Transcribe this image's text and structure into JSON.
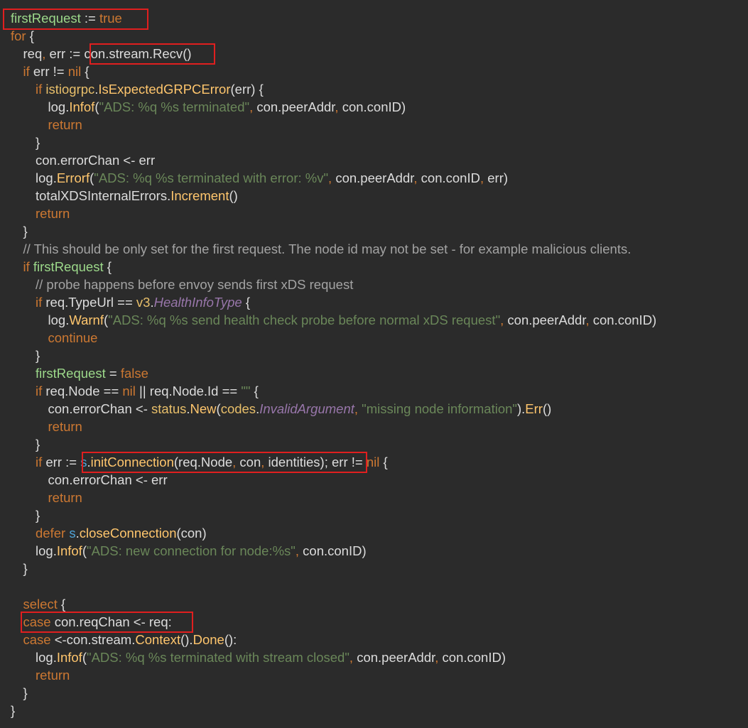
{
  "code": {
    "lines": [
      {
        "indent": 0,
        "tokens": [
          {
            "t": "firstRequest",
            "c": "var"
          },
          {
            "t": " := "
          },
          {
            "t": "true",
            "c": "kw"
          }
        ]
      },
      {
        "indent": 0,
        "tokens": [
          {
            "t": "for",
            "c": "kw"
          },
          {
            "t": " {"
          }
        ]
      },
      {
        "indent": 1,
        "tokens": [
          {
            "t": "req"
          },
          {
            "t": ", ",
            "c": "kw"
          },
          {
            "t": "err"
          },
          {
            "t": " := "
          },
          {
            "t": "con.stream.Recv"
          },
          {
            "t": "()"
          }
        ]
      },
      {
        "indent": 1,
        "tokens": [
          {
            "t": "if",
            "c": "kw"
          },
          {
            "t": " err != "
          },
          {
            "t": "nil",
            "c": "kw"
          },
          {
            "t": " {"
          }
        ]
      },
      {
        "indent": 2,
        "tokens": [
          {
            "t": "if",
            "c": "kw"
          },
          {
            "t": " "
          },
          {
            "t": "istiogrpc",
            "c": "pkg"
          },
          {
            "t": "."
          },
          {
            "t": "IsExpectedGRPCError",
            "c": "fn"
          },
          {
            "t": "(err) {"
          }
        ]
      },
      {
        "indent": 3,
        "tokens": [
          {
            "t": "log."
          },
          {
            "t": "Infof",
            "c": "fn"
          },
          {
            "t": "("
          },
          {
            "t": "\"ADS: %q %s terminated\"",
            "c": "str"
          },
          {
            "t": ", ",
            "c": "kw"
          },
          {
            "t": "con.peerAddr"
          },
          {
            "t": ", ",
            "c": "kw"
          },
          {
            "t": "con.conID)"
          }
        ]
      },
      {
        "indent": 3,
        "tokens": [
          {
            "t": "return",
            "c": "kw"
          }
        ]
      },
      {
        "indent": 2,
        "tokens": [
          {
            "t": "}"
          }
        ]
      },
      {
        "indent": 2,
        "tokens": [
          {
            "t": "con.errorChan <- err"
          }
        ]
      },
      {
        "indent": 2,
        "tokens": [
          {
            "t": "log."
          },
          {
            "t": "Errorf",
            "c": "fn"
          },
          {
            "t": "("
          },
          {
            "t": "\"ADS: %q %s terminated with error: %v\"",
            "c": "str"
          },
          {
            "t": ", ",
            "c": "kw"
          },
          {
            "t": "con.peerAddr"
          },
          {
            "t": ", ",
            "c": "kw"
          },
          {
            "t": "con.conID"
          },
          {
            "t": ", ",
            "c": "kw"
          },
          {
            "t": "err)"
          }
        ]
      },
      {
        "indent": 2,
        "tokens": [
          {
            "t": "totalXDSInternalErrors."
          },
          {
            "t": "Increment",
            "c": "fn"
          },
          {
            "t": "()"
          }
        ]
      },
      {
        "indent": 2,
        "tokens": [
          {
            "t": "return",
            "c": "kw"
          }
        ]
      },
      {
        "indent": 1,
        "tokens": [
          {
            "t": "}"
          }
        ]
      },
      {
        "indent": 1,
        "tokens": [
          {
            "t": "// This should be only set for the first request. The node id may not be set - for example malicious clients.",
            "c": "cm"
          }
        ]
      },
      {
        "indent": 1,
        "tokens": [
          {
            "t": "if",
            "c": "kw"
          },
          {
            "t": " "
          },
          {
            "t": "firstRequest",
            "c": "var"
          },
          {
            "t": " {"
          }
        ]
      },
      {
        "indent": 2,
        "tokens": [
          {
            "t": "// probe happens before envoy sends first xDS request",
            "c": "cm"
          }
        ]
      },
      {
        "indent": 2,
        "tokens": [
          {
            "t": "if",
            "c": "kw"
          },
          {
            "t": " req.TypeUrl == "
          },
          {
            "t": "v3",
            "c": "pkg"
          },
          {
            "t": "."
          },
          {
            "t": "HealthInfoType",
            "c": "it"
          },
          {
            "t": " {"
          }
        ]
      },
      {
        "indent": 3,
        "tokens": [
          {
            "t": "log."
          },
          {
            "t": "Warnf",
            "c": "fn"
          },
          {
            "t": "("
          },
          {
            "t": "\"ADS: %q %s send health check probe before normal xDS request\"",
            "c": "str"
          },
          {
            "t": ", ",
            "c": "kw"
          },
          {
            "t": "con.peerAddr"
          },
          {
            "t": ", ",
            "c": "kw"
          },
          {
            "t": "con.conID)"
          }
        ]
      },
      {
        "indent": 3,
        "tokens": [
          {
            "t": "continue",
            "c": "kw"
          }
        ]
      },
      {
        "indent": 2,
        "tokens": [
          {
            "t": "}"
          }
        ]
      },
      {
        "indent": 2,
        "tokens": [
          {
            "t": "firstRequest",
            "c": "var"
          },
          {
            "t": " = "
          },
          {
            "t": "false",
            "c": "kw"
          }
        ]
      },
      {
        "indent": 2,
        "tokens": [
          {
            "t": "if",
            "c": "kw"
          },
          {
            "t": " req.Node == "
          },
          {
            "t": "nil",
            "c": "kw"
          },
          {
            "t": " || req.Node.Id == "
          },
          {
            "t": "\"\"",
            "c": "str"
          },
          {
            "t": " {"
          }
        ]
      },
      {
        "indent": 3,
        "tokens": [
          {
            "t": "con.errorChan <- "
          },
          {
            "t": "status",
            "c": "pkg"
          },
          {
            "t": "."
          },
          {
            "t": "New",
            "c": "fn"
          },
          {
            "t": "("
          },
          {
            "t": "codes",
            "c": "pkg"
          },
          {
            "t": "."
          },
          {
            "t": "InvalidArgument",
            "c": "it"
          },
          {
            "t": ", ",
            "c": "kw"
          },
          {
            "t": "\"missing node information\"",
            "c": "str"
          },
          {
            "t": ")."
          },
          {
            "t": "Err",
            "c": "fn"
          },
          {
            "t": "()"
          }
        ]
      },
      {
        "indent": 3,
        "tokens": [
          {
            "t": "return",
            "c": "kw"
          }
        ]
      },
      {
        "indent": 2,
        "tokens": [
          {
            "t": "}"
          }
        ]
      },
      {
        "indent": 2,
        "tokens": [
          {
            "t": "if",
            "c": "kw"
          },
          {
            "t": " err := "
          },
          {
            "t": "s",
            "c": "recv"
          },
          {
            "t": "."
          },
          {
            "t": "initConnection",
            "c": "fn"
          },
          {
            "t": "(req.Node"
          },
          {
            "t": ", ",
            "c": "kw"
          },
          {
            "t": "con"
          },
          {
            "t": ", ",
            "c": "kw"
          },
          {
            "t": "identities)"
          },
          {
            "t": "; "
          },
          {
            "t": "err != "
          },
          {
            "t": "nil",
            "c": "kw"
          },
          {
            "t": " {"
          }
        ]
      },
      {
        "indent": 3,
        "tokens": [
          {
            "t": "con.errorChan <- err"
          }
        ]
      },
      {
        "indent": 3,
        "tokens": [
          {
            "t": "return",
            "c": "kw"
          }
        ]
      },
      {
        "indent": 2,
        "tokens": [
          {
            "t": "}"
          }
        ]
      },
      {
        "indent": 2,
        "tokens": [
          {
            "t": "defer",
            "c": "kw"
          },
          {
            "t": " "
          },
          {
            "t": "s",
            "c": "recv"
          },
          {
            "t": "."
          },
          {
            "t": "closeConnection",
            "c": "fn"
          },
          {
            "t": "(con)"
          }
        ]
      },
      {
        "indent": 2,
        "tokens": [
          {
            "t": "log."
          },
          {
            "t": "Infof",
            "c": "fn"
          },
          {
            "t": "("
          },
          {
            "t": "\"ADS: new connection for node:%s\"",
            "c": "str"
          },
          {
            "t": ", ",
            "c": "kw"
          },
          {
            "t": "con.conID)"
          }
        ]
      },
      {
        "indent": 1,
        "tokens": [
          {
            "t": "}"
          }
        ]
      },
      {
        "indent": 1,
        "tokens": []
      },
      {
        "indent": 1,
        "tokens": [
          {
            "t": "select",
            "c": "kw"
          },
          {
            "t": " {"
          }
        ]
      },
      {
        "indent": 1,
        "tokens": [
          {
            "t": "case",
            "c": "kw"
          },
          {
            "t": " con.reqChan <- req:"
          }
        ]
      },
      {
        "indent": 1,
        "tokens": [
          {
            "t": "case",
            "c": "kw"
          },
          {
            "t": " <-con.stream."
          },
          {
            "t": "Context",
            "c": "fn"
          },
          {
            "t": "()."
          },
          {
            "t": "Done",
            "c": "fn"
          },
          {
            "t": "():"
          }
        ]
      },
      {
        "indent": 2,
        "tokens": [
          {
            "t": "log."
          },
          {
            "t": "Infof",
            "c": "fn"
          },
          {
            "t": "("
          },
          {
            "t": "\"ADS: %q %s terminated with stream closed\"",
            "c": "str"
          },
          {
            "t": ", ",
            "c": "kw"
          },
          {
            "t": "con.peerAddr"
          },
          {
            "t": ", ",
            "c": "kw"
          },
          {
            "t": "con.conID)"
          }
        ]
      },
      {
        "indent": 2,
        "tokens": [
          {
            "t": "return",
            "c": "kw"
          }
        ]
      },
      {
        "indent": 1,
        "tokens": [
          {
            "t": "}"
          }
        ]
      },
      {
        "indent": 0,
        "tokens": [
          {
            "t": "}"
          }
        ]
      }
    ]
  },
  "colors": {
    "background": "#2b2b2b",
    "text": "#dcdcdc",
    "keyword": "#cc7832",
    "function": "#ffc66d",
    "string": "#6a8759",
    "comment": "#a3a3a3",
    "variable": "#9cd88a",
    "italic_constant": "#9876aa",
    "highlight_border": "#e01f1f"
  }
}
